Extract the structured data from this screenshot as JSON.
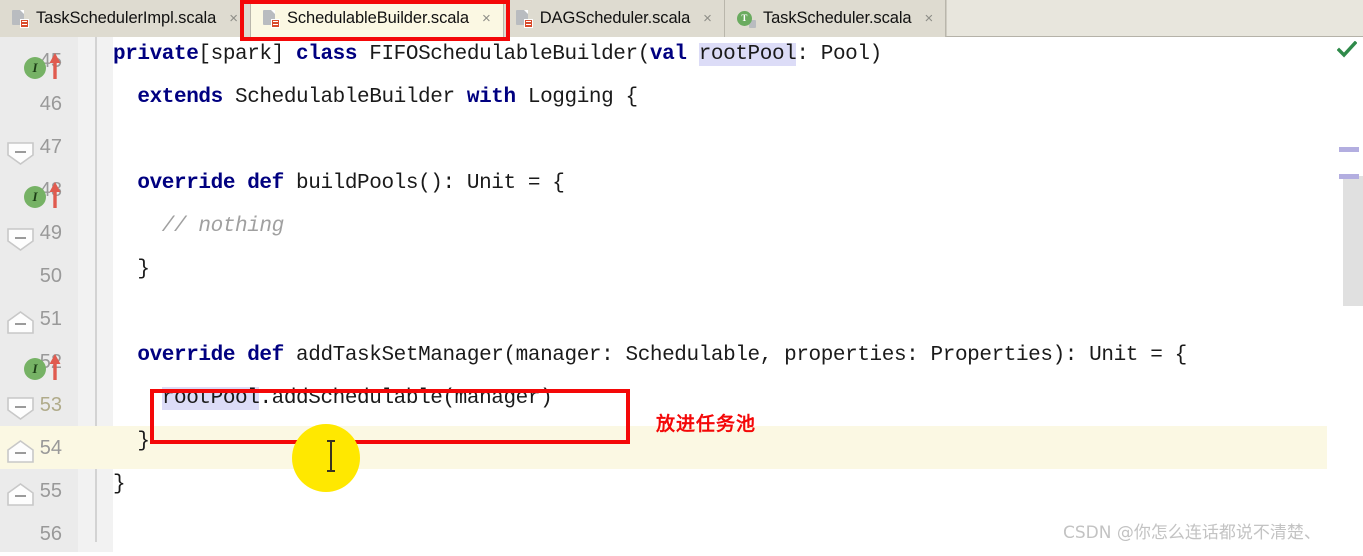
{
  "tabs": [
    {
      "label": "TaskSchedulerImpl.scala",
      "icon": "scala-file-icon",
      "active": false,
      "close": "×"
    },
    {
      "label": "SchedulableBuilder.scala",
      "icon": "scala-file-icon",
      "active": true,
      "close": "×"
    },
    {
      "label": "DAGScheduler.scala",
      "icon": "scala-file-icon",
      "active": false,
      "close": "×"
    },
    {
      "label": "TaskScheduler.scala",
      "icon": "trait-icon",
      "active": false,
      "close": "×"
    }
  ],
  "editor": {
    "lines": [
      {
        "num": "45",
        "current": false,
        "marker": true,
        "fold": "",
        "code": "private[spark] class FIFOSchedulableBuilder(val rootPool: Pool)"
      },
      {
        "num": "46",
        "current": false,
        "marker": false,
        "fold": "open",
        "code": "  extends SchedulableBuilder with Logging {"
      },
      {
        "num": "47",
        "current": false,
        "marker": false,
        "fold": "",
        "code": ""
      },
      {
        "num": "48",
        "current": false,
        "marker": true,
        "fold": "open",
        "code": "  override def buildPools(): Unit = {"
      },
      {
        "num": "49",
        "current": false,
        "marker": false,
        "fold": "",
        "code": "    // nothing"
      },
      {
        "num": "50",
        "current": false,
        "marker": false,
        "fold": "close",
        "code": "  }"
      },
      {
        "num": "51",
        "current": false,
        "marker": false,
        "fold": "",
        "code": ""
      },
      {
        "num": "52",
        "current": false,
        "marker": true,
        "fold": "open",
        "code": "  override def addTaskSetManager(manager: Schedulable, properties: Properties): Unit = {"
      },
      {
        "num": "53",
        "current": true,
        "marker": false,
        "fold": "",
        "code": "    rootPool.addSchedulable(manager)"
      },
      {
        "num": "54",
        "current": false,
        "marker": false,
        "fold": "close",
        "code": "  }"
      },
      {
        "num": "55",
        "current": false,
        "marker": false,
        "fold": "close",
        "code": "}"
      },
      {
        "num": "56",
        "current": false,
        "marker": false,
        "fold": "",
        "code": ""
      }
    ],
    "highlighted_identifier": "rootPool",
    "marker_icon_letter": "I"
  },
  "annotations": {
    "code_note": "放进任务池",
    "note_color": "#f40808",
    "box_color": "#f40808",
    "tab_box_target": "SchedulableBuilder.scala",
    "code_box_target": "rootPool.addSchedulable(manager)"
  },
  "watermark": {
    "text": "CSDN @你怎么连话都说不清楚、"
  },
  "scrollbar": {
    "inspection_status": "ok-check-icon",
    "marker_count": 2
  },
  "theme": {
    "keyword_color": "#000080",
    "comment_color": "#a0a0a0",
    "current_line_bg": "#fbf8e3",
    "identifier_highlight_bg": "#dcdcf7",
    "gutter_bg": "#ebebeb",
    "tab_active_bg": "#fbf8e3"
  }
}
